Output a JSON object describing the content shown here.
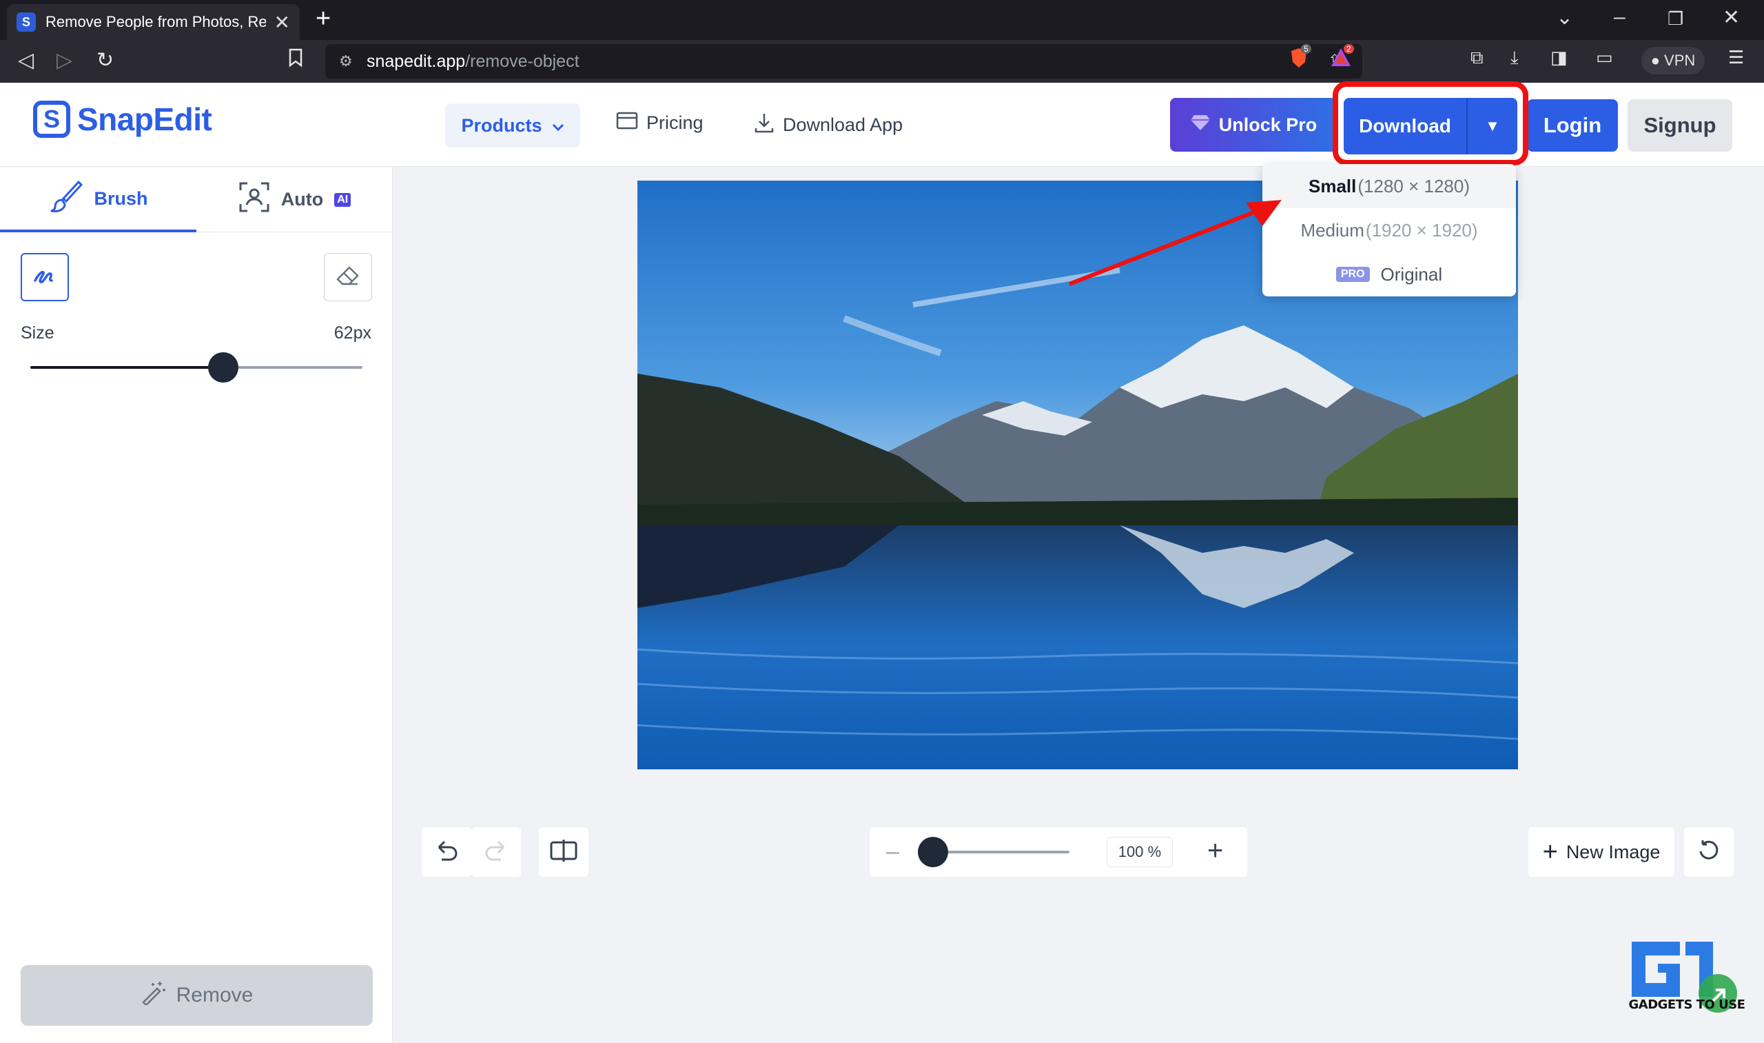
{
  "browser": {
    "tab_title": "Remove People from Photos, Rer",
    "favicon_letter": "S",
    "url_host": "snapedit.app",
    "url_path": "/remove-object",
    "brave_count": "5",
    "alert_count": "2",
    "vpn_label": "VPN"
  },
  "header": {
    "logo_text": "SnapEdit",
    "logo_mark": "S",
    "nav": {
      "products": "Products",
      "pricing": "Pricing",
      "download_app": "Download App"
    },
    "unlock_pro": "Unlock Pro",
    "download": "Download",
    "login": "Login",
    "signup": "Signup"
  },
  "download_menu": {
    "items": [
      {
        "name": "Small",
        "dims": "(1280 × 1280)"
      },
      {
        "name": "Medium",
        "dims": "(1920 × 1920)"
      },
      {
        "badge": "PRO",
        "name": "Original"
      }
    ]
  },
  "left_panel": {
    "tabs": {
      "brush": "Brush",
      "auto": "Auto",
      "auto_badge": "AI"
    },
    "size_label": "Size",
    "size_value": "62px",
    "size_slider_fraction": 0.58,
    "remove_button": "Remove"
  },
  "toolbar": {
    "zoom_value": "100 %",
    "zoom_slider_fraction": 0.0,
    "new_image": "New Image"
  },
  "watermark": {
    "text": "GADGETS TO USE"
  },
  "colors": {
    "brand": "#2c5ee5",
    "highlight": "#ee1111",
    "browser_dark": "#1c1b22"
  }
}
